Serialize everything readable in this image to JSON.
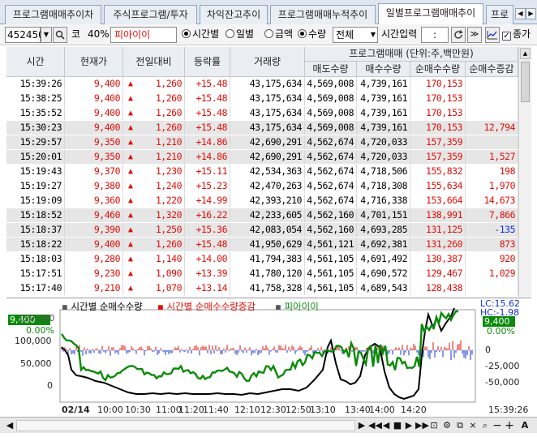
{
  "tabs": [
    "프로그램매매추이차",
    "주식프로그램/투자",
    "차익잔고추이",
    "프로그램매매누적추이",
    "일별프로그램매매추이",
    "프로"
  ],
  "active_tab": 4,
  "toolbar": {
    "code": "452450",
    "market": "코",
    "margin": "40%",
    "stock_name": "피아이이",
    "radio_time": "시간별",
    "radio_day": "일별",
    "radio_amount": "금액",
    "radio_qty": "수량",
    "scope": "전체",
    "time_input_label": "시간입력",
    "time_input_value": ":",
    "close_price_label": "종가"
  },
  "table": {
    "headers": {
      "time": "시간",
      "price": "현재가",
      "change": "전일대비",
      "rate": "등락률",
      "volume": "거래량",
      "program_group": "프로그램매매 (단위:주,백만원)",
      "sell": "매도수량",
      "buy": "매수수량",
      "net": "순매수수량",
      "net_change": "순매수증감"
    },
    "rows": [
      {
        "time": "15:39:26",
        "price": "9,400",
        "change": "1,260",
        "rate": "+15.48",
        "volume": "43,175,634",
        "sell": "4,569,008",
        "buy": "4,739,161",
        "net": "170,153",
        "net_change": "",
        "shade": false
      },
      {
        "time": "15:38:25",
        "price": "9,400",
        "change": "1,260",
        "rate": "+15.48",
        "volume": "43,175,634",
        "sell": "4,569,008",
        "buy": "4,739,161",
        "net": "170,153",
        "net_change": "",
        "shade": false
      },
      {
        "time": "15:35:52",
        "price": "9,400",
        "change": "1,260",
        "rate": "+15.48",
        "volume": "43,175,634",
        "sell": "4,569,008",
        "buy": "4,739,161",
        "net": "170,153",
        "net_change": "",
        "shade": false
      },
      {
        "time": "15:30:23",
        "price": "9,400",
        "change": "1,260",
        "rate": "+15.48",
        "volume": "43,175,634",
        "sell": "4,569,008",
        "buy": "4,739,161",
        "net": "170,153",
        "net_change": "12,794",
        "shade": true
      },
      {
        "time": "15:29:57",
        "price": "9,350",
        "change": "1,210",
        "rate": "+14.86",
        "volume": "42,690,291",
        "sell": "4,562,674",
        "buy": "4,720,033",
        "net": "157,359",
        "net_change": "",
        "shade": true
      },
      {
        "time": "15:20:01",
        "price": "9,350",
        "change": "1,210",
        "rate": "+14.86",
        "volume": "42,690,291",
        "sell": "4,562,674",
        "buy": "4,720,033",
        "net": "157,359",
        "net_change": "1,527",
        "shade": true
      },
      {
        "time": "15:19:43",
        "price": "9,370",
        "change": "1,230",
        "rate": "+15.11",
        "volume": "42,534,363",
        "sell": "4,562,674",
        "buy": "4,718,506",
        "net": "155,832",
        "net_change": "198",
        "shade": false
      },
      {
        "time": "15:19:27",
        "price": "9,380",
        "change": "1,240",
        "rate": "+15.23",
        "volume": "42,470,263",
        "sell": "4,562,674",
        "buy": "4,718,308",
        "net": "155,634",
        "net_change": "1,970",
        "shade": false
      },
      {
        "time": "15:19:09",
        "price": "9,360",
        "change": "1,220",
        "rate": "+14.99",
        "volume": "42,393,210",
        "sell": "4,562,674",
        "buy": "4,716,338",
        "net": "153,664",
        "net_change": "14,673",
        "shade": false
      },
      {
        "time": "15:18:52",
        "price": "9,460",
        "change": "1,320",
        "rate": "+16.22",
        "volume": "42,233,605",
        "sell": "4,562,160",
        "buy": "4,701,151",
        "net": "138,991",
        "net_change": "7,866",
        "shade": true
      },
      {
        "time": "15:18:37",
        "price": "9,390",
        "change": "1,250",
        "rate": "+15.36",
        "volume": "42,083,054",
        "sell": "4,562,160",
        "buy": "4,693,285",
        "net": "131,125",
        "net_change": "-135",
        "shade": true
      },
      {
        "time": "15:18:22",
        "price": "9,400",
        "change": "1,260",
        "rate": "+15.48",
        "volume": "41,950,629",
        "sell": "4,561,121",
        "buy": "4,692,381",
        "net": "131,260",
        "net_change": "873",
        "shade": true
      },
      {
        "time": "15:18:03",
        "price": "9,280",
        "change": "1,140",
        "rate": "+14.00",
        "volume": "41,794,383",
        "sell": "4,561,105",
        "buy": "4,691,492",
        "net": "130,387",
        "net_change": "920",
        "shade": false
      },
      {
        "time": "15:17:51",
        "price": "9,230",
        "change": "1,090",
        "rate": "+13.39",
        "volume": "41,780,120",
        "sell": "4,561,105",
        "buy": "4,690,572",
        "net": "129,467",
        "net_change": "1,029",
        "shade": false
      },
      {
        "time": "15:17:40",
        "price": "9,210",
        "change": "1,070",
        "rate": "+13.14",
        "volume": "41,758,328",
        "sell": "4,561,105",
        "buy": "4,689,543",
        "net": "128,438",
        "net_change": "",
        "shade": false
      }
    ]
  },
  "chart": {
    "legend": [
      "시간별 순매수수량",
      "시간별 순매수수량증감",
      "피아이이"
    ],
    "left_price_badge": "9,400",
    "left_pct": "0.00%",
    "right_lc": "LC:15.62",
    "right_hc": "HC:-1.98",
    "right_price_badge": "9,400",
    "right_pct": "0.00%",
    "left_ticks": [
      "150,000",
      "100,000",
      "50,000",
      "0"
    ],
    "right_ticks": [
      "0",
      "-25,000",
      "-50,000"
    ],
    "x_date": "02/14",
    "x_ticks": [
      "10:00",
      "10:30",
      "11:00",
      "11:20",
      "11:40",
      "12:10",
      "12:30",
      "12:50",
      "13:10",
      "13:40",
      "14:00",
      "14:20"
    ],
    "x_end": "15:39:26",
    "colors": {
      "green": "#0a8a0a",
      "black": "#000000",
      "red": "#e0100a",
      "blue": "#1430d8",
      "badge": "#0a8a0a"
    }
  },
  "bottom_bar_icons": [
    "scroll-left-icon",
    "rewind-icon",
    "prev-icon",
    "stop-icon",
    "next-icon",
    "fast-forward-icon",
    "settings-icon",
    "zoom-out-icon",
    "zoom-in-icon",
    "font-icon"
  ]
}
